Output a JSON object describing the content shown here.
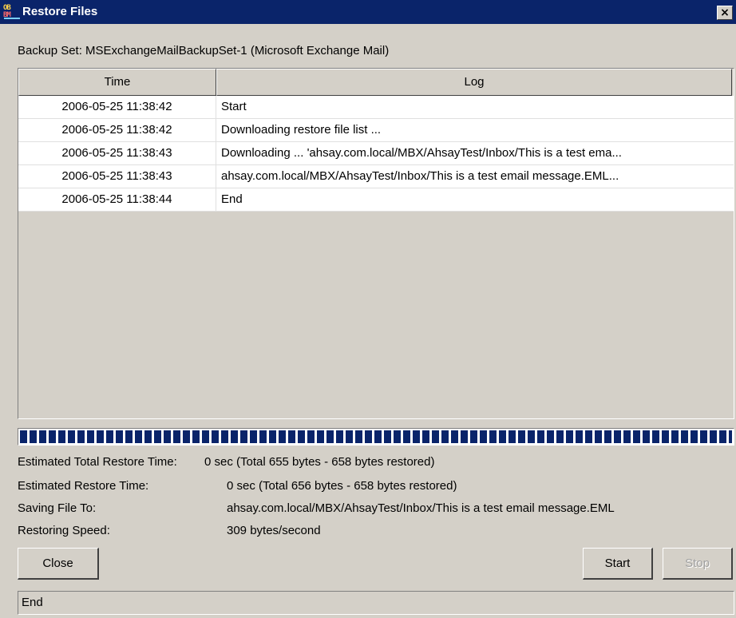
{
  "window": {
    "title": "Restore Files",
    "close_glyph": "×",
    "icon": "app-icon"
  },
  "backup_set": "Backup Set: MSExchangeMailBackupSet-1 (Microsoft Exchange Mail)",
  "table": {
    "columns": [
      "Time",
      "Log"
    ],
    "rows": [
      {
        "time": "2006-05-25 11:38:42",
        "log": "Start"
      },
      {
        "time": "2006-05-25 11:38:42",
        "log": "Downloading restore file list ..."
      },
      {
        "time": "2006-05-25 11:38:43",
        "log": "Downloading ... 'ahsay.com.local/MBX/AhsayTest/Inbox/This is a test ema..."
      },
      {
        "time": "2006-05-25 11:38:43",
        "log": "ahsay.com.local/MBX/AhsayTest/Inbox/This is a test email message.EML..."
      },
      {
        "time": "2006-05-25 11:38:44",
        "log": "End"
      }
    ]
  },
  "progress": {
    "fraction": 1.0,
    "color": "#0a246a"
  },
  "stats": {
    "total_time_label": "Estimated Total Restore Time:",
    "total_time_value": "0 sec (Total 655 bytes - 658 bytes restored)",
    "restore_time_label": "Estimated Restore Time:",
    "restore_time_value": "0 sec (Total 656 bytes - 658 bytes restored)",
    "saving_label": "Saving File To:",
    "saving_value": "ahsay.com.local/MBX/AhsayTest/Inbox/This is a test email message.EML",
    "speed_label": "Restoring Speed:",
    "speed_value": "309 bytes/second"
  },
  "buttons": {
    "close": "Close",
    "start": "Start",
    "stop": "Stop"
  },
  "status": "End"
}
